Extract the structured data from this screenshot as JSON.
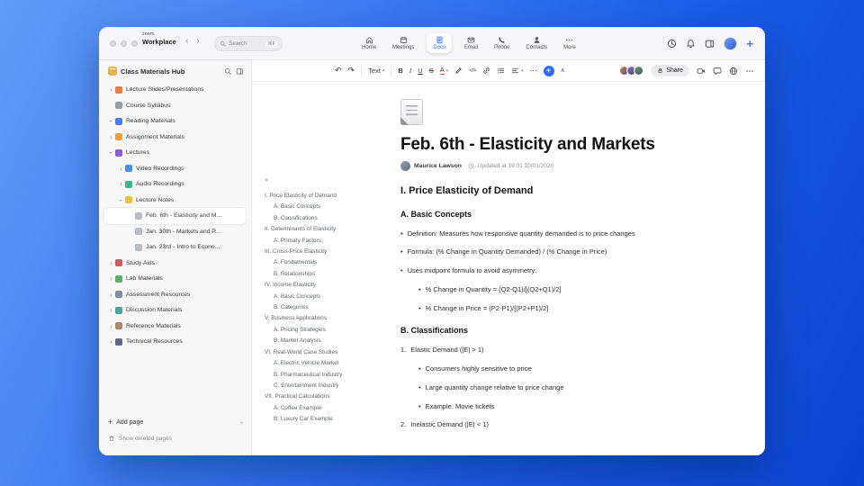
{
  "colors": {
    "accent": "#2f6bff",
    "window_bg": "#ffffff",
    "sidebar_bg": "#f7f7f8",
    "background_gradient": [
      "#5f9bf7",
      "#0a43cf"
    ]
  },
  "titlebar": {
    "logo_top": "zoom",
    "logo_bottom": "Workplace",
    "back_arrow": "‹",
    "forward_arrow": "›",
    "search": {
      "placeholder": "Search",
      "shortcut": "⌘F"
    },
    "tabs": [
      {
        "label": "Home",
        "icon": "home-icon",
        "active": false
      },
      {
        "label": "Meetings",
        "icon": "meetings-icon",
        "active": false
      },
      {
        "label": "Docs",
        "icon": "docs-icon",
        "active": true
      },
      {
        "label": "Email",
        "icon": "email-icon",
        "active": false
      },
      {
        "label": "Phone",
        "icon": "phone-icon",
        "active": false
      },
      {
        "label": "Contacts",
        "icon": "contacts-icon",
        "active": false
      },
      {
        "label": "More",
        "icon": "more-icon",
        "active": false
      }
    ],
    "actions": [
      {
        "name": "history-button",
        "icon": "clock-icon"
      },
      {
        "name": "notifications-button",
        "icon": "bell-icon"
      },
      {
        "name": "layout-button",
        "icon": "panel-icon"
      }
    ],
    "plus_label": "+"
  },
  "sidebar": {
    "title": "Class Materials Hub",
    "items": [
      {
        "label": "Lecture Slides/Presentations",
        "icon": "slides-icon",
        "color": "#e67e42",
        "chevron": "right",
        "level": 0,
        "selected": false
      },
      {
        "label": "Course Syllabus",
        "icon": "syllabus-icon",
        "color": "#9aa0a6",
        "chevron": "none",
        "level": 0,
        "selected": false
      },
      {
        "label": "Reading Materials",
        "icon": "reading-icon",
        "color": "#4a7de8",
        "chevron": "down",
        "level": 0,
        "selected": false
      },
      {
        "label": "Assignment Materials",
        "icon": "assignment-icon",
        "color": "#e8a03c",
        "chevron": "right",
        "level": 0,
        "selected": false
      },
      {
        "label": "Lectures",
        "icon": "lectures-icon",
        "color": "#8a5fd6",
        "chevron": "down",
        "level": 0,
        "selected": false
      },
      {
        "label": "Video Recordings",
        "icon": "video-icon",
        "color": "#4a90e8",
        "chevron": "right",
        "level": 1,
        "selected": false
      },
      {
        "label": "Audio Recordings",
        "icon": "audio-icon",
        "color": "#3eb489",
        "chevron": "right",
        "level": 1,
        "selected": false
      },
      {
        "label": "Lecture Notes",
        "icon": "notes-icon",
        "color": "#e8c23c",
        "chevron": "down",
        "level": 1,
        "selected": false
      },
      {
        "label": "Feb. 6th - Elasticity and M...",
        "icon": "page-icon",
        "color": "#b9bdc4",
        "chevron": "none",
        "level": 2,
        "selected": true
      },
      {
        "label": "Jan. 30th - Markets and P...",
        "icon": "page-icon",
        "color": "#b9bdc4",
        "chevron": "none",
        "level": 2,
        "selected": false
      },
      {
        "label": "Jan. 23rd - Intro to Econo...",
        "icon": "page-icon",
        "color": "#b9bdc4",
        "chevron": "none",
        "level": 2,
        "selected": false
      },
      {
        "label": "Study Aids",
        "icon": "study-icon",
        "color": "#d65c5c",
        "chevron": "right",
        "level": 0,
        "selected": false
      },
      {
        "label": "Lab Materials",
        "icon": "lab-icon",
        "color": "#57b368",
        "chevron": "right",
        "level": 0,
        "selected": false
      },
      {
        "label": "Assessment Resources",
        "icon": "assessment-icon",
        "color": "#7f8aa3",
        "chevron": "right",
        "level": 0,
        "selected": false
      },
      {
        "label": "Discussion Materials",
        "icon": "discussion-icon",
        "color": "#4ba3a3",
        "chevron": "right",
        "level": 0,
        "selected": false
      },
      {
        "label": "Reference Materials",
        "icon": "reference-icon",
        "color": "#b08968",
        "chevron": "right",
        "level": 0,
        "selected": false
      },
      {
        "label": "Technical Resources",
        "icon": "technical-icon",
        "color": "#5c6b82",
        "chevron": "right",
        "level": 0,
        "selected": false
      }
    ],
    "add_page": "Add page",
    "show_deleted": "Show deleted pages"
  },
  "toolbar": {
    "buttons": [
      {
        "name": "undo-button",
        "glyph": "↶"
      },
      {
        "name": "redo-button",
        "glyph": "↷"
      },
      {
        "name": "divider"
      },
      {
        "name": "text-style-dropdown",
        "glyph": "Text",
        "chevron": true
      },
      {
        "name": "divider"
      },
      {
        "name": "bold-button",
        "glyph": "B"
      },
      {
        "name": "italic-button",
        "glyph": "I"
      },
      {
        "name": "underline-button",
        "glyph": "U"
      },
      {
        "name": "strikethrough-button",
        "glyph": "S"
      },
      {
        "name": "text-color-button",
        "glyph": "A",
        "chevron": true
      },
      {
        "name": "highlight-button",
        "icon": "pencil-icon"
      },
      {
        "name": "code-button",
        "glyph": "</>"
      },
      {
        "name": "link-button",
        "icon": "link-icon"
      },
      {
        "name": "list-button",
        "icon": "list-icon"
      },
      {
        "name": "align-button",
        "icon": "align-icon",
        "chevron": true
      },
      {
        "name": "more-formatting-button",
        "glyph": "⋯"
      },
      {
        "name": "insert-button",
        "glyph": "+",
        "accent": true
      },
      {
        "name": "collapse-toolbar-button",
        "glyph": "∧"
      }
    ],
    "collaborators": [
      "#d98a5e",
      "#8f6fd9",
      "#5fae6b"
    ],
    "share_label": "Share",
    "right_buttons": [
      {
        "name": "video-call-button",
        "icon": "camera-icon"
      },
      {
        "name": "comments-button",
        "icon": "comment-icon"
      },
      {
        "name": "browser-button",
        "icon": "globe-icon"
      },
      {
        "name": "more-options-button",
        "icon": "more-icon"
      }
    ]
  },
  "outline": {
    "items": [
      {
        "label": "I. Price Elasticity of Demand",
        "level": 0
      },
      {
        "label": "A. Basic Concepts",
        "level": 1
      },
      {
        "label": "B. Classifications",
        "level": 1
      },
      {
        "label": "II. Determinants of Elasticity",
        "level": 0
      },
      {
        "label": "A. Primary Factors",
        "level": 1
      },
      {
        "label": "III. Cross-Price Elasticity",
        "level": 0
      },
      {
        "label": "A. Fundamentals",
        "level": 1
      },
      {
        "label": "B. Relationships",
        "level": 1
      },
      {
        "label": "IV. Income Elasticity",
        "level": 0
      },
      {
        "label": "A. Basic Concepts",
        "level": 1
      },
      {
        "label": "B. Categories",
        "level": 1
      },
      {
        "label": "V. Business Applications",
        "level": 0
      },
      {
        "label": "A. Pricing Strategies",
        "level": 1
      },
      {
        "label": "B. Market Analysis",
        "level": 1
      },
      {
        "label": "VI. Real-World Case Studies",
        "level": 0
      },
      {
        "label": "A. Electric Vehicle Market",
        "level": 1
      },
      {
        "label": "B. Pharmaceutical Industry",
        "level": 1
      },
      {
        "label": "C. Entertainment Industry",
        "level": 1
      },
      {
        "label": "VII. Practical Calculations",
        "level": 0
      },
      {
        "label": "A. Coffee Example",
        "level": 1
      },
      {
        "label": "B. Luxury Car Example",
        "level": 1
      }
    ]
  },
  "doc": {
    "title": "Feb. 6th - Elasticity and Markets",
    "author": "Maurice Lawson",
    "updated": "Updated at 19:01 10/01/2020",
    "blocks": [
      {
        "type": "h2",
        "text": "I. Price Elasticity of Demand"
      },
      {
        "type": "h3",
        "text": "A. Basic Concepts"
      },
      {
        "type": "bullet",
        "level": 0,
        "text": "Definition: Measures how responsive quantity demanded is to price changes"
      },
      {
        "type": "bullet",
        "level": 0,
        "text": "Formula: (% Change in Quantity Demanded) / (% Change in Price)"
      },
      {
        "type": "bullet",
        "level": 0,
        "text": "Uses midpoint formula to avoid asymmetry:"
      },
      {
        "type": "bullet",
        "level": 1,
        "text": "% Change in Quantity = (Q2-Q1)/[(Q2+Q1)/2]"
      },
      {
        "type": "bullet",
        "level": 1,
        "text": "% Change in Price = (P2-P1)/[(P2+P1)/2]"
      },
      {
        "type": "h3",
        "text": "B. Classifications"
      },
      {
        "type": "num",
        "num": "1.",
        "text": "Elastic Demand (|E| > 1)"
      },
      {
        "type": "bullet",
        "level": 1,
        "text": "Consumers highly sensitive to price"
      },
      {
        "type": "bullet",
        "level": 1,
        "text": "Large quantity change relative to price change"
      },
      {
        "type": "bullet",
        "level": 1,
        "text": "Example: Movie tickets"
      },
      {
        "type": "num",
        "num": "2.",
        "text": "Inelastic Demand (|E| < 1)"
      }
    ]
  }
}
